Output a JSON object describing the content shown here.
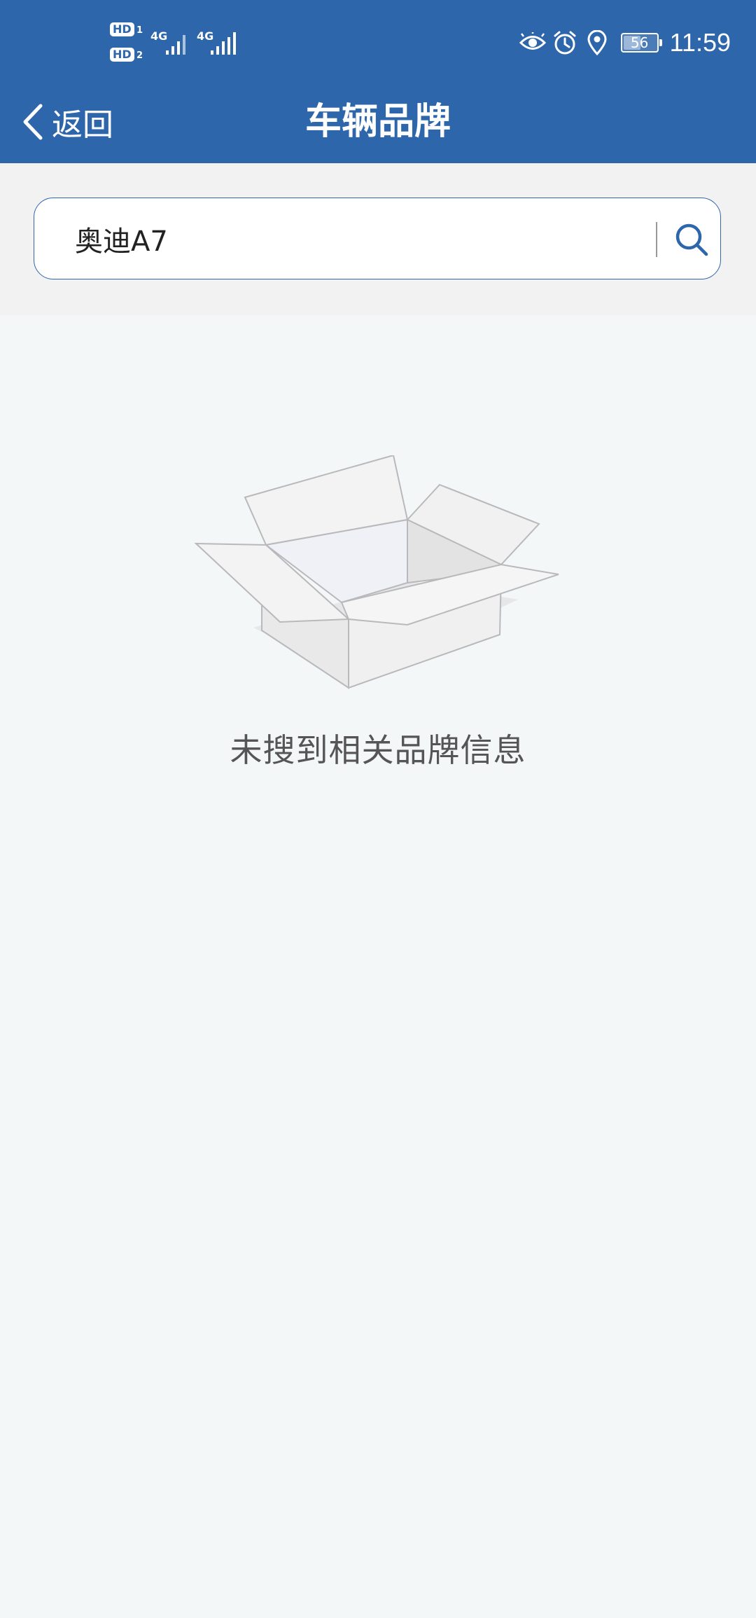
{
  "status_bar": {
    "hd1": "HD",
    "hd1_sub": "1",
    "hd2": "HD",
    "hd2_sub": "2",
    "net1": "4G",
    "net2": "4G",
    "battery": "56",
    "battery_level": 0.56,
    "time": "11:59",
    "icons": [
      "eye-icon",
      "alarm-icon",
      "location-icon"
    ]
  },
  "nav": {
    "back_label": "返回",
    "title": "车辆品牌"
  },
  "search": {
    "value": "奥迪A7",
    "placeholder": ""
  },
  "empty_state": {
    "message": "未搜到相关品牌信息"
  },
  "colors": {
    "primary": "#2d66ab",
    "background": "#f4f7f8",
    "search_area": "#f2f2f2"
  }
}
